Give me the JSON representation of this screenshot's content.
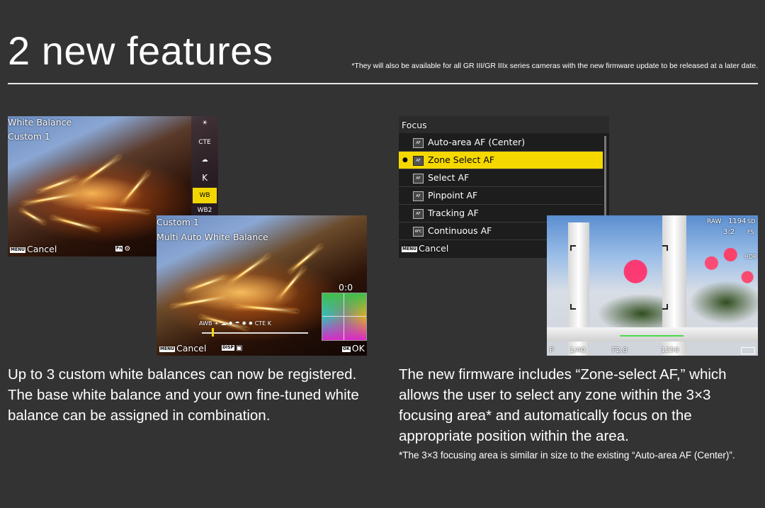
{
  "header": {
    "title": "2 new features",
    "note": "*They will also be available for all GR III/GR IIIx series cameras with the new firmware update to be released at a later date."
  },
  "wb_screen_1": {
    "title": "White Balance",
    "selected": "Custom 1",
    "cancel_key": "MENU",
    "cancel_label": "Cancel",
    "fn_key": "Fn",
    "strip_items": [
      "☀",
      "CTE",
      "☁",
      "K",
      "WB",
      "WB2"
    ]
  },
  "wb_screen_2": {
    "title": "Custom 1",
    "subtitle": "Multi Auto White Balance",
    "adjust_value": "0:0",
    "cancel_key": "MENU",
    "cancel_label": "Cancel",
    "disp_key": "DISP",
    "ok_key": "OK",
    "ok_label": "OK"
  },
  "focus_menu": {
    "title": "Focus",
    "items": [
      {
        "label": "Auto-area AF (Center)",
        "icon": "AF"
      },
      {
        "label": "Zone Select AF",
        "icon": "AF"
      },
      {
        "label": "Select AF",
        "icon": "AF"
      },
      {
        "label": "Pinpoint AF",
        "icon": "AF"
      },
      {
        "label": "Tracking AF",
        "icon": "AF"
      },
      {
        "label": "Continuous AF",
        "icon": "AFC"
      }
    ],
    "selected_index": 1,
    "cancel_key": "MENU",
    "cancel_label": "Cancel"
  },
  "live_view": {
    "raw": "RAW",
    "shots": "1194",
    "card": "SD",
    "aspect": "3:2",
    "quality": "FS",
    "hdr": "HDR",
    "mode": "P",
    "shutter": "1/40",
    "aperture": "F2.8",
    "iso": "1250"
  },
  "left_text": "Up to 3 custom white balances can now be registered. The base white balance and your own fine-tuned white balance can be assigned in combination.",
  "right_text": "The new firmware includes “Zone-select AF,” which allows the user to select any zone within the 3×3 focusing area* and automatically focus on the appropriate position within the area.",
  "right_note": "*The 3×3 focusing area is similar in size to the existing “Auto-area AF (Center)”.",
  "colors": {
    "background": "#333333",
    "highlight": "#f5d800"
  }
}
